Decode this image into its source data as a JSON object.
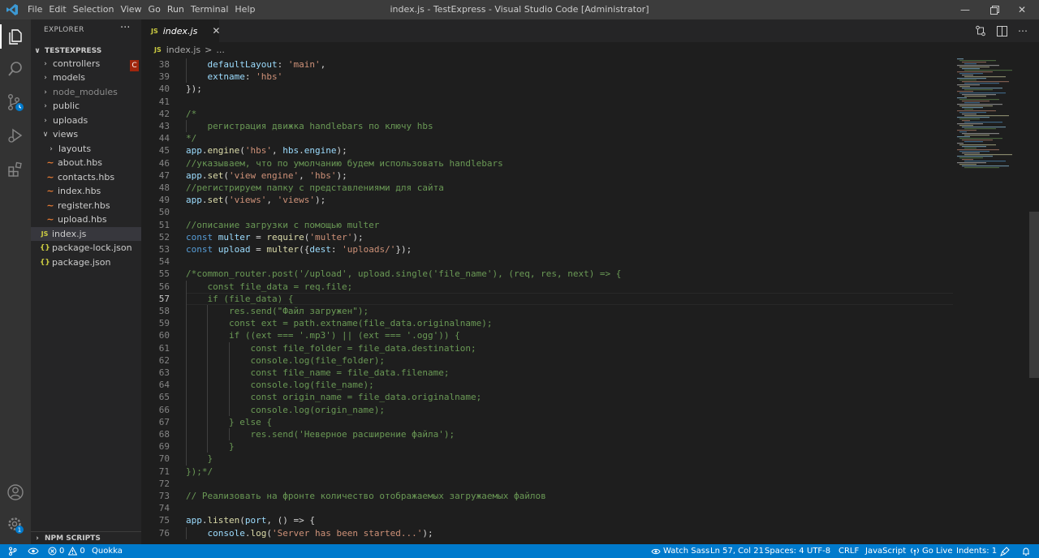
{
  "titlebar": {
    "menu": [
      "File",
      "Edit",
      "Selection",
      "View",
      "Go",
      "Run",
      "Terminal",
      "Help"
    ],
    "title": "index.js - TestExpress - Visual Studio Code [Administrator]"
  },
  "sidebar": {
    "title": "EXPLORER",
    "more": "···",
    "project": "TESTEXPRESS",
    "items": [
      {
        "label": "controllers",
        "badge": "C"
      },
      {
        "label": "models"
      },
      {
        "label": "node_modules"
      },
      {
        "label": "public"
      },
      {
        "label": "uploads"
      },
      {
        "label": "views"
      },
      {
        "label": "layouts"
      },
      {
        "label": "about.hbs"
      },
      {
        "label": "contacts.hbs"
      },
      {
        "label": "index.hbs"
      },
      {
        "label": "register.hbs"
      },
      {
        "label": "upload.hbs"
      },
      {
        "label": "index.js"
      },
      {
        "label": "package-lock.json"
      },
      {
        "label": "package.json"
      }
    ],
    "npm_scripts": "NPM SCRIPTS",
    "file_icon_js": "JS",
    "file_icon_json": "{}"
  },
  "editor": {
    "tab_label": "index.js",
    "tab_icon": "JS",
    "breadcrumb_file": "index.js",
    "breadcrumb_sep": ">",
    "breadcrumb_more": "...",
    "lines": [
      {
        "n": "38",
        "text": "    defaultLayout: 'main',"
      },
      {
        "n": "39",
        "text": "    extname: 'hbs'"
      },
      {
        "n": "40",
        "text": "});"
      },
      {
        "n": "41",
        "text": ""
      },
      {
        "n": "42",
        "text": "/*"
      },
      {
        "n": "43",
        "text": "    регистрация движка handlebars по ключу hbs"
      },
      {
        "n": "44",
        "text": "*/"
      },
      {
        "n": "45",
        "text": "app.engine('hbs', hbs.engine);"
      },
      {
        "n": "46",
        "text": "//указываем, что по умолчанию будем использовать handlebars"
      },
      {
        "n": "47",
        "text": "app.set('view engine', 'hbs');"
      },
      {
        "n": "48",
        "text": "//регистрируем папку с представлениями для сайта"
      },
      {
        "n": "49",
        "text": "app.set('views', 'views');"
      },
      {
        "n": "50",
        "text": ""
      },
      {
        "n": "51",
        "text": "//описание загрузки с помощью multer"
      },
      {
        "n": "52",
        "text": "const multer = require('multer');"
      },
      {
        "n": "53",
        "text": "const upload = multer({dest: 'uploads/'});"
      },
      {
        "n": "54",
        "text": ""
      },
      {
        "n": "55",
        "text": "/*common_router.post('/upload', upload.single('file_name'), (req, res, next) => {"
      },
      {
        "n": "56",
        "text": "    const file_data = req.file;"
      },
      {
        "n": "57",
        "text": "    if (file_data) {"
      },
      {
        "n": "58",
        "text": "        res.send(\"Файл загружен\");"
      },
      {
        "n": "59",
        "text": "        const ext = path.extname(file_data.originalname);"
      },
      {
        "n": "60",
        "text": "        if ((ext === '.mp3') || (ext === '.ogg')) {"
      },
      {
        "n": "61",
        "text": "            const file_folder = file_data.destination;"
      },
      {
        "n": "62",
        "text": "            console.log(file_folder);"
      },
      {
        "n": "63",
        "text": "            const file_name = file_data.filename;"
      },
      {
        "n": "64",
        "text": "            console.log(file_name);"
      },
      {
        "n": "65",
        "text": "            const origin_name = file_data.originalname;"
      },
      {
        "n": "66",
        "text": "            console.log(origin_name);"
      },
      {
        "n": "67",
        "text": "        } else {"
      },
      {
        "n": "68",
        "text": "            res.send('Неверное расширение файла');"
      },
      {
        "n": "69",
        "text": "        }"
      },
      {
        "n": "70",
        "text": "    }"
      },
      {
        "n": "71",
        "text": "});*/"
      },
      {
        "n": "72",
        "text": ""
      },
      {
        "n": "73",
        "text": "// Реализовать на фронте количество отображаемых загружаемых файлов"
      },
      {
        "n": "74",
        "text": ""
      },
      {
        "n": "75",
        "text": "app.listen(port, () => {"
      },
      {
        "n": "76",
        "text": "    console.log('Server has been started...');"
      }
    ]
  },
  "statusbar": {
    "errors": "0",
    "warnings": "0",
    "quokka": "Quokka",
    "watch_sass": "Watch Sass",
    "position": "Ln 57, Col 21",
    "spaces": "Spaces: 4",
    "encoding": "UTF-8",
    "eol": "CRLF",
    "language": "JavaScript",
    "go_live": "Go Live",
    "indents": "Indents: 1"
  },
  "colors": {
    "statusbar": "#007acc",
    "activity_bar": "#333333",
    "sidebar": "#252526",
    "editor": "#1e1e1e",
    "keyword": "#569cd6",
    "string": "#ce9178",
    "comment": "#6a9955",
    "variable": "#9cdcfe",
    "function": "#dcdcaa"
  }
}
